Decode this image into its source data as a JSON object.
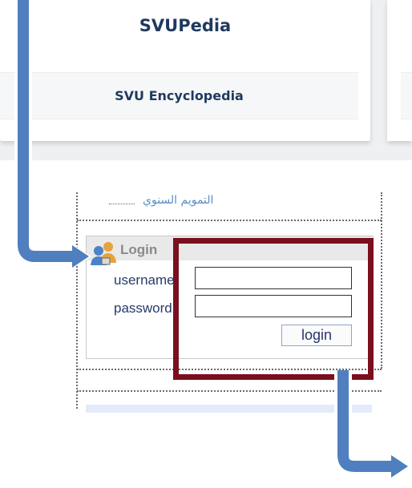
{
  "card": {
    "title": "SVUPedia",
    "subtitle": "SVU Encyclopedia"
  },
  "widget": {
    "arabic_link": "التمويم السنوي",
    "login_title": "Login",
    "username_label": "username",
    "password_label": "password",
    "username_value": "",
    "password_value": "",
    "login_button": "login"
  },
  "colors": {
    "highlight": "#7a0f1d",
    "arrow": "#4f7fbf",
    "title": "#1f3a5f"
  },
  "icons": [
    "user-login-icon",
    "arrow-down-right-icon"
  ]
}
